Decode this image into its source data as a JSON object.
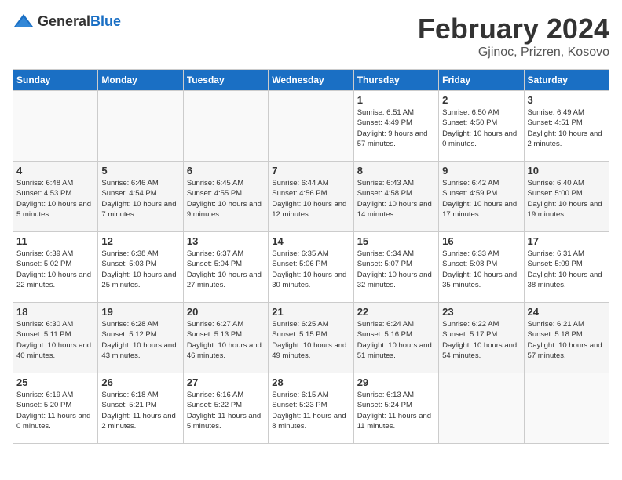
{
  "header": {
    "logo_general": "General",
    "logo_blue": "Blue",
    "title": "February 2024",
    "subtitle": "Gjinoc, Prizren, Kosovo"
  },
  "weekdays": [
    "Sunday",
    "Monday",
    "Tuesday",
    "Wednesday",
    "Thursday",
    "Friday",
    "Saturday"
  ],
  "weeks": [
    [
      {
        "day": "",
        "sunrise": "",
        "sunset": "",
        "daylight": "",
        "empty": true
      },
      {
        "day": "",
        "sunrise": "",
        "sunset": "",
        "daylight": "",
        "empty": true
      },
      {
        "day": "",
        "sunrise": "",
        "sunset": "",
        "daylight": "",
        "empty": true
      },
      {
        "day": "",
        "sunrise": "",
        "sunset": "",
        "daylight": "",
        "empty": true
      },
      {
        "day": "1",
        "sunrise": "6:51 AM",
        "sunset": "4:49 PM",
        "daylight": "9 hours and 57 minutes."
      },
      {
        "day": "2",
        "sunrise": "6:50 AM",
        "sunset": "4:50 PM",
        "daylight": "10 hours and 0 minutes."
      },
      {
        "day": "3",
        "sunrise": "6:49 AM",
        "sunset": "4:51 PM",
        "daylight": "10 hours and 2 minutes."
      }
    ],
    [
      {
        "day": "4",
        "sunrise": "6:48 AM",
        "sunset": "4:53 PM",
        "daylight": "10 hours and 5 minutes."
      },
      {
        "day": "5",
        "sunrise": "6:46 AM",
        "sunset": "4:54 PM",
        "daylight": "10 hours and 7 minutes."
      },
      {
        "day": "6",
        "sunrise": "6:45 AM",
        "sunset": "4:55 PM",
        "daylight": "10 hours and 9 minutes."
      },
      {
        "day": "7",
        "sunrise": "6:44 AM",
        "sunset": "4:56 PM",
        "daylight": "10 hours and 12 minutes."
      },
      {
        "day": "8",
        "sunrise": "6:43 AM",
        "sunset": "4:58 PM",
        "daylight": "10 hours and 14 minutes."
      },
      {
        "day": "9",
        "sunrise": "6:42 AM",
        "sunset": "4:59 PM",
        "daylight": "10 hours and 17 minutes."
      },
      {
        "day": "10",
        "sunrise": "6:40 AM",
        "sunset": "5:00 PM",
        "daylight": "10 hours and 19 minutes."
      }
    ],
    [
      {
        "day": "11",
        "sunrise": "6:39 AM",
        "sunset": "5:02 PM",
        "daylight": "10 hours and 22 minutes."
      },
      {
        "day": "12",
        "sunrise": "6:38 AM",
        "sunset": "5:03 PM",
        "daylight": "10 hours and 25 minutes."
      },
      {
        "day": "13",
        "sunrise": "6:37 AM",
        "sunset": "5:04 PM",
        "daylight": "10 hours and 27 minutes."
      },
      {
        "day": "14",
        "sunrise": "6:35 AM",
        "sunset": "5:06 PM",
        "daylight": "10 hours and 30 minutes."
      },
      {
        "day": "15",
        "sunrise": "6:34 AM",
        "sunset": "5:07 PM",
        "daylight": "10 hours and 32 minutes."
      },
      {
        "day": "16",
        "sunrise": "6:33 AM",
        "sunset": "5:08 PM",
        "daylight": "10 hours and 35 minutes."
      },
      {
        "day": "17",
        "sunrise": "6:31 AM",
        "sunset": "5:09 PM",
        "daylight": "10 hours and 38 minutes."
      }
    ],
    [
      {
        "day": "18",
        "sunrise": "6:30 AM",
        "sunset": "5:11 PM",
        "daylight": "10 hours and 40 minutes."
      },
      {
        "day": "19",
        "sunrise": "6:28 AM",
        "sunset": "5:12 PM",
        "daylight": "10 hours and 43 minutes."
      },
      {
        "day": "20",
        "sunrise": "6:27 AM",
        "sunset": "5:13 PM",
        "daylight": "10 hours and 46 minutes."
      },
      {
        "day": "21",
        "sunrise": "6:25 AM",
        "sunset": "5:15 PM",
        "daylight": "10 hours and 49 minutes."
      },
      {
        "day": "22",
        "sunrise": "6:24 AM",
        "sunset": "5:16 PM",
        "daylight": "10 hours and 51 minutes."
      },
      {
        "day": "23",
        "sunrise": "6:22 AM",
        "sunset": "5:17 PM",
        "daylight": "10 hours and 54 minutes."
      },
      {
        "day": "24",
        "sunrise": "6:21 AM",
        "sunset": "5:18 PM",
        "daylight": "10 hours and 57 minutes."
      }
    ],
    [
      {
        "day": "25",
        "sunrise": "6:19 AM",
        "sunset": "5:20 PM",
        "daylight": "11 hours and 0 minutes."
      },
      {
        "day": "26",
        "sunrise": "6:18 AM",
        "sunset": "5:21 PM",
        "daylight": "11 hours and 2 minutes."
      },
      {
        "day": "27",
        "sunrise": "6:16 AM",
        "sunset": "5:22 PM",
        "daylight": "11 hours and 5 minutes."
      },
      {
        "day": "28",
        "sunrise": "6:15 AM",
        "sunset": "5:23 PM",
        "daylight": "11 hours and 8 minutes."
      },
      {
        "day": "29",
        "sunrise": "6:13 AM",
        "sunset": "5:24 PM",
        "daylight": "11 hours and 11 minutes."
      },
      {
        "day": "",
        "sunrise": "",
        "sunset": "",
        "daylight": "",
        "empty": true
      },
      {
        "day": "",
        "sunrise": "",
        "sunset": "",
        "daylight": "",
        "empty": true
      }
    ]
  ]
}
